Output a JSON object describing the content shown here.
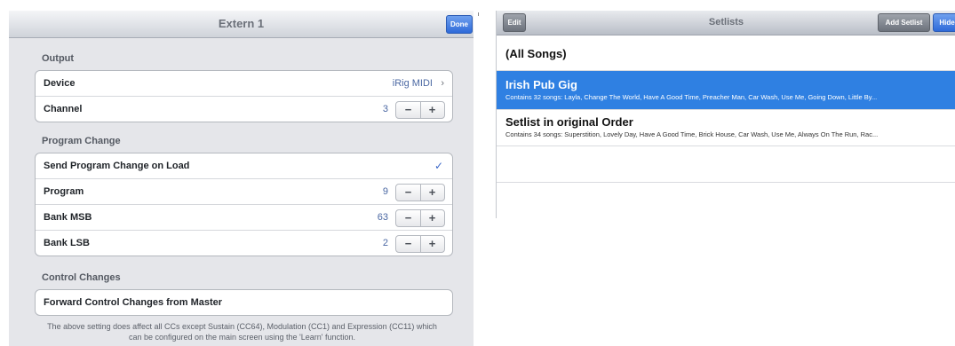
{
  "left_panel": {
    "title": "Extern 1",
    "done_label": "Done",
    "sections": {
      "output": "Output",
      "program_change": "Program Change",
      "control_changes": "Control Changes"
    },
    "rows": {
      "device": {
        "label": "Device",
        "value": "iRig MIDI"
      },
      "channel": {
        "label": "Channel",
        "value": "3"
      },
      "send_pc": {
        "label": "Send Program Change on Load",
        "checked": true
      },
      "program": {
        "label": "Program",
        "value": "9"
      },
      "bank_msb": {
        "label": "Bank MSB",
        "value": "63"
      },
      "bank_lsb": {
        "label": "Bank LSB",
        "value": "2"
      },
      "forward_cc": {
        "label": "Forward Control Changes from Master"
      }
    },
    "stepper": {
      "minus": "−",
      "plus": "+"
    },
    "chevron": "›",
    "checkmark": "✓",
    "footnote": "The above setting does affect all CCs except Sustain (CC64), Modulation (CC1) and Expression (CC11) which can be configured on the main screen using the 'Learn' function."
  },
  "right_panel": {
    "title": "Setlists",
    "edit_label": "Edit",
    "add_label": "Add Setlist",
    "hide_label": "Hide",
    "items": [
      {
        "title": "(All Songs)",
        "subtitle": ""
      },
      {
        "title": "Irish Pub Gig",
        "subtitle": "Contains 32 songs: Layla, Change The World, Have A Good Time, Preacher Man, Car Wash, Use Me, Going Down, Little By..."
      },
      {
        "title": "Setlist in original Order",
        "subtitle": "Contains 34 songs: Superstition, Lovely Day, Have A Good Time, Brick House, Car Wash, Use Me, Always On The Run, Rac..."
      }
    ],
    "selected_index": 1
  },
  "colors": {
    "accent_blue": "#2f80e2",
    "value_text": "#4b68a3",
    "panel_bg": "#e5e6ea"
  }
}
